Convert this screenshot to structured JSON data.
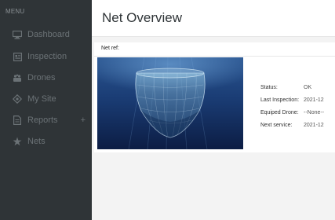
{
  "sidebar": {
    "menu_label": "MENU",
    "items": [
      {
        "label": "Dashboard",
        "icon": "monitor-icon"
      },
      {
        "label": "Inspection",
        "icon": "inspection-icon"
      },
      {
        "label": "Drones",
        "icon": "drone-icon"
      },
      {
        "label": "My Site",
        "icon": "site-icon"
      },
      {
        "label": "Reports",
        "icon": "report-icon",
        "extra": "+"
      },
      {
        "label": "Nets",
        "icon": "nets-icon"
      }
    ]
  },
  "header": {
    "title": "Net Overview"
  },
  "card": {
    "net_ref_label": "Net ref:",
    "details": [
      {
        "key": "Status:",
        "value": "OK"
      },
      {
        "key": "Last Inspection:",
        "value": "2021-12"
      },
      {
        "key": "Equiped Drone:",
        "value": "--None--"
      },
      {
        "key": "Next service:",
        "value": "2021-12"
      }
    ]
  },
  "colors": {
    "sidebar_bg": "#2f3437",
    "sidebar_text": "#6b7276",
    "water_top": "#1d3f78",
    "water_bottom": "#0e2148"
  }
}
